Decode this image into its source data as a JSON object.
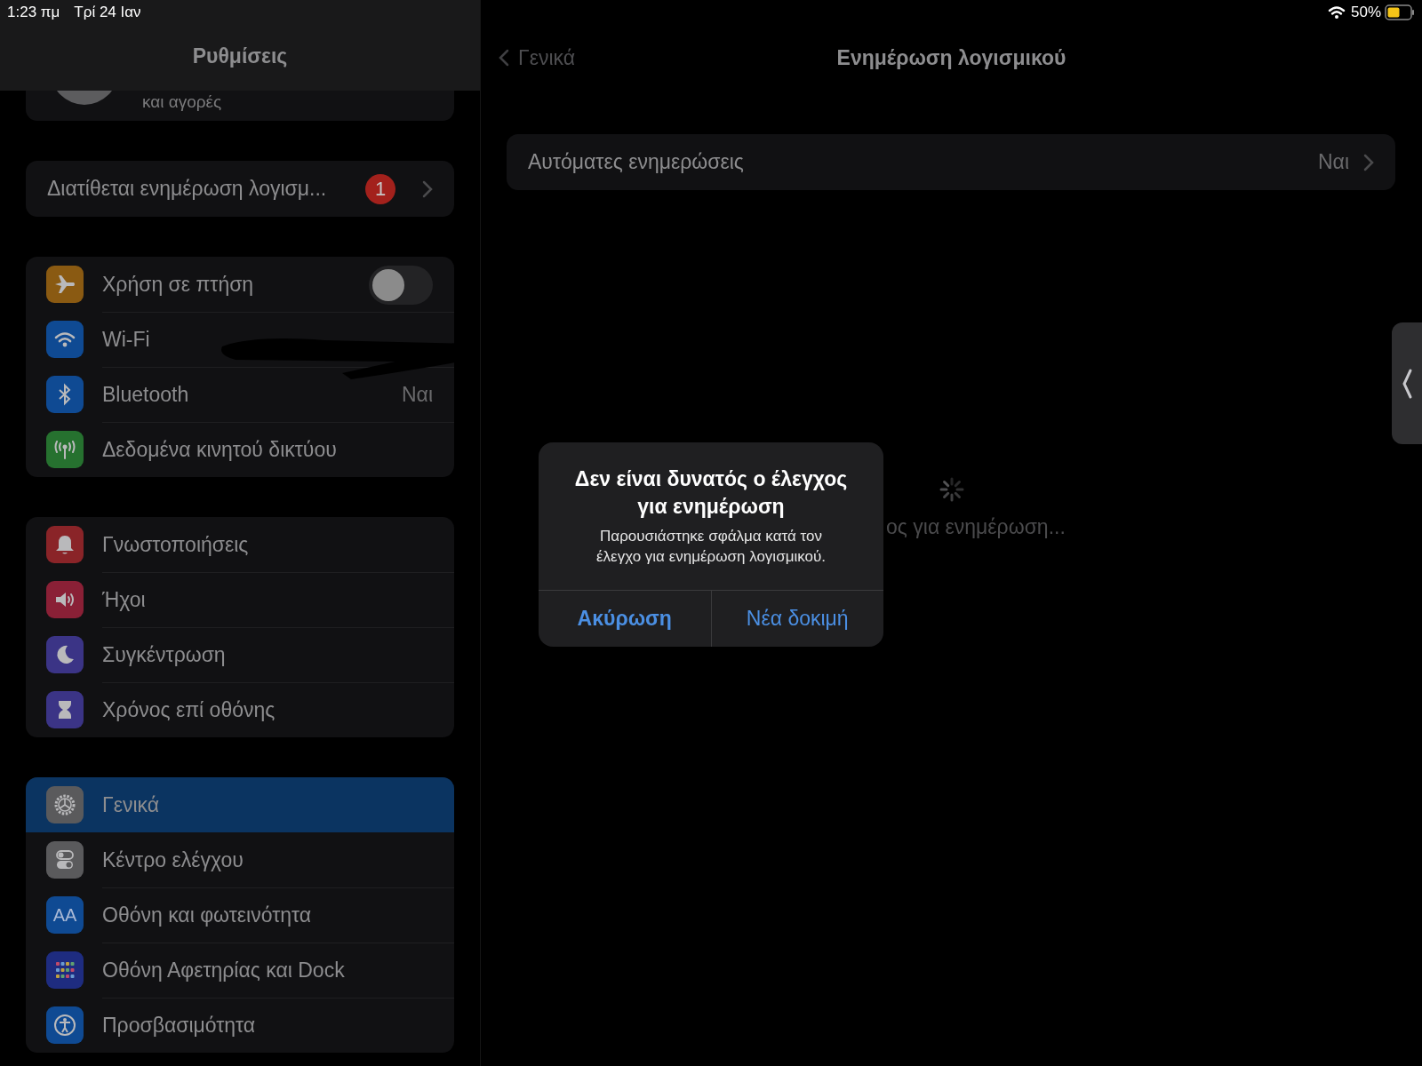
{
  "status_bar": {
    "time": "1:23 πμ",
    "date": "Τρί 24 Ιαν",
    "battery": "50%"
  },
  "sidebar": {
    "title": "Ρυθμίσεις",
    "profile": {
      "subtitle": "και αγορές"
    },
    "update_banner": {
      "label": "Διατίθεται ενημέρωση λογισμ...",
      "badge": "1"
    },
    "groups": [
      [
        {
          "label": "Χρήση σε πτήση",
          "kind": "toggle",
          "on": false,
          "selected": false
        },
        {
          "label": "Wi-Fi",
          "kind": "link",
          "selected": false
        },
        {
          "label": "Bluetooth",
          "kind": "link",
          "value": "Ναι",
          "selected": false
        },
        {
          "label": "Δεδομένα κινητού δικτύου",
          "kind": "link",
          "selected": false
        }
      ],
      [
        {
          "label": "Γνωστοποιήσεις",
          "kind": "link",
          "selected": false
        },
        {
          "label": "Ήχοι",
          "kind": "link",
          "selected": false
        },
        {
          "label": "Συγκέντρωση",
          "kind": "link",
          "selected": false
        },
        {
          "label": "Χρόνος επί οθόνης",
          "kind": "link",
          "selected": false
        }
      ],
      [
        {
          "label": "Γενικά",
          "kind": "link",
          "selected": true
        },
        {
          "label": "Κέντρο ελέγχου",
          "kind": "link",
          "selected": false
        },
        {
          "label": "Οθόνη και φωτεινότητα",
          "icon_text": "AA",
          "kind": "link",
          "selected": false
        },
        {
          "label": "Οθόνη Αφετηρίας και Dock",
          "kind": "link",
          "selected": false
        },
        {
          "label": "Προσβασιμότητα",
          "kind": "link",
          "selected": false
        }
      ]
    ]
  },
  "detail": {
    "back": "Γενικά",
    "title": "Ενημέρωση λογισμικού",
    "rows": [
      {
        "label": "Αυτόματες ενημερώσεις",
        "value": "Ναι"
      }
    ],
    "status": "ος για ενημέρωση..."
  },
  "alert": {
    "title": "Δεν είναι δυνατός ο έλεγχος για ενημέρωση",
    "message": "Παρουσιάστηκε σφάλμα κατά τον έλεγχο για ενημέρωση λογισμικού.",
    "buttons": [
      {
        "label": "Ακύρωση",
        "kind": "cancel"
      },
      {
        "label": "Νέα δοκιμή",
        "kind": "default"
      }
    ]
  }
}
